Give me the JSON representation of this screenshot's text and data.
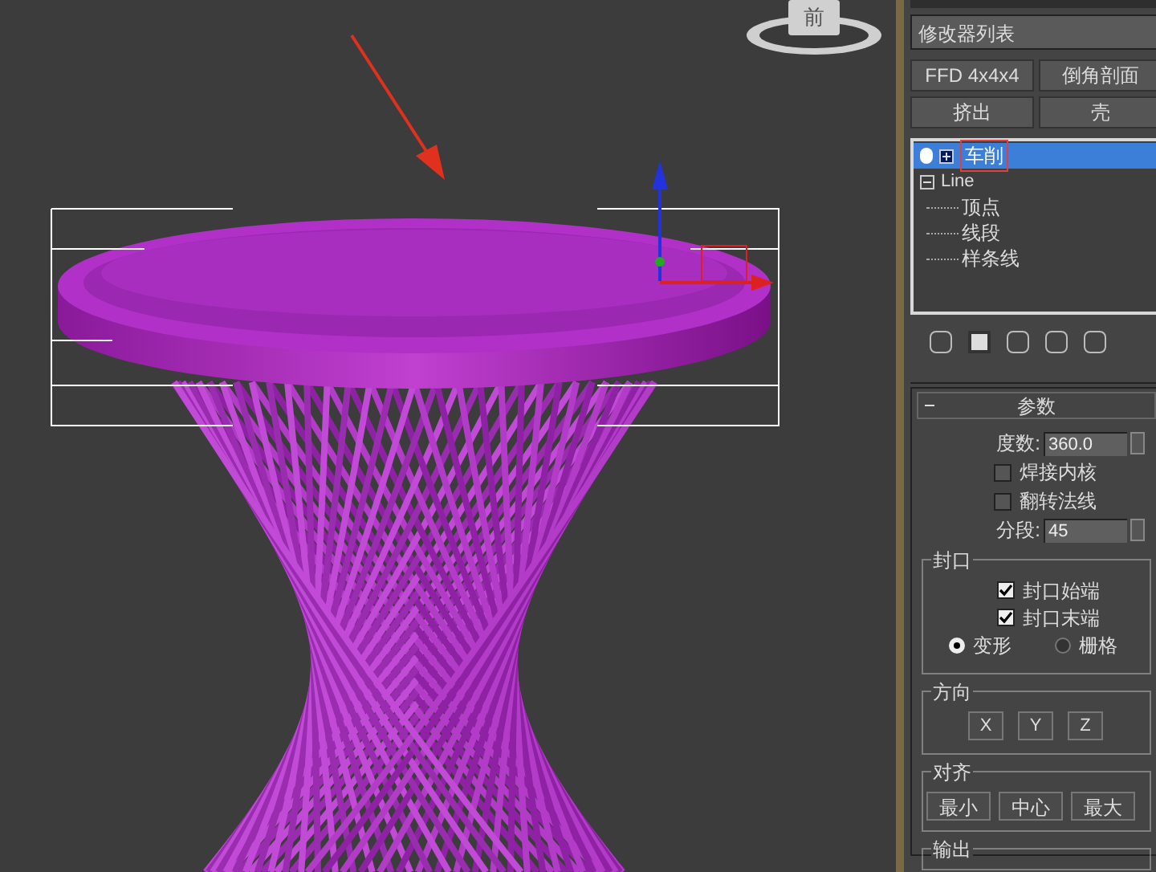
{
  "viewport": {
    "viewcube_label": "前"
  },
  "modifier_list": {
    "label": "修改器列表"
  },
  "modifier_buttons": [
    "FFD 4x4x4",
    "倒角剖面",
    "挤出",
    "壳"
  ],
  "stack": [
    {
      "label": "车削",
      "selected": true,
      "expanded": false
    },
    {
      "label": "Line",
      "selected": false,
      "expanded": true,
      "children": [
        {
          "label": "顶点"
        },
        {
          "label": "线段"
        },
        {
          "label": "样条线"
        }
      ]
    }
  ],
  "params": {
    "title": "参数",
    "fields": [
      {
        "kind": "spinner",
        "label": "度数:",
        "value": "360.0"
      },
      {
        "kind": "checkbox",
        "label": "焊接内核",
        "checked": false
      },
      {
        "kind": "checkbox",
        "label": "翻转法线",
        "checked": false
      },
      {
        "kind": "spinner",
        "label": "分段:",
        "value": "45"
      }
    ]
  },
  "cap": {
    "title": "封口",
    "checks": [
      {
        "label": "封口始端",
        "checked": true
      },
      {
        "label": "封口末端",
        "checked": true
      }
    ],
    "radios": [
      {
        "label": "变形",
        "selected": true
      },
      {
        "label": "栅格",
        "selected": false
      }
    ]
  },
  "direction": {
    "title": "方向",
    "buttons": [
      "X",
      "Y",
      "Z"
    ]
  },
  "align": {
    "title": "对齐",
    "buttons": [
      "最小",
      "中心",
      "最大"
    ]
  },
  "output": {
    "title": "输出"
  }
}
